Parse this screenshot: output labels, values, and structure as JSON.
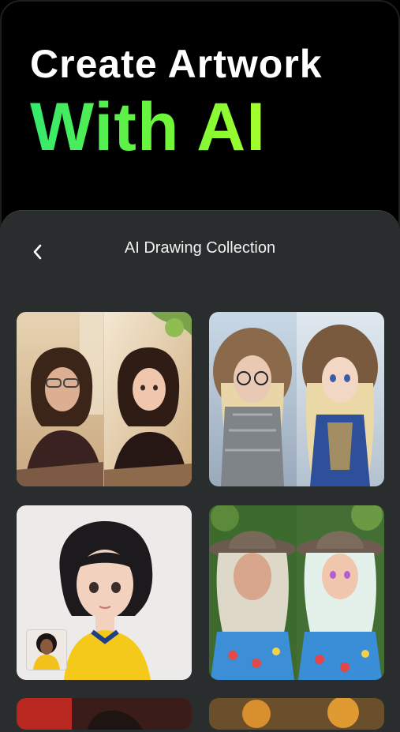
{
  "hero": {
    "line1": "Create Artwork",
    "line2": "With AI"
  },
  "panel": {
    "title": "AI Drawing Collection",
    "back_icon": "chevron-left-icon"
  },
  "gallery": [
    {
      "name": "glasses-woman-sofa",
      "style": "before-after"
    },
    {
      "name": "fur-hood-woman",
      "style": "before-after"
    },
    {
      "name": "short-hair-girl-yellow-top",
      "style": "single-with-thumb"
    },
    {
      "name": "cowboy-hat-woman",
      "style": "before-after"
    }
  ],
  "colors": {
    "background": "#000000",
    "panel": "#2a2d2e",
    "accent_green": "#45ee55"
  }
}
